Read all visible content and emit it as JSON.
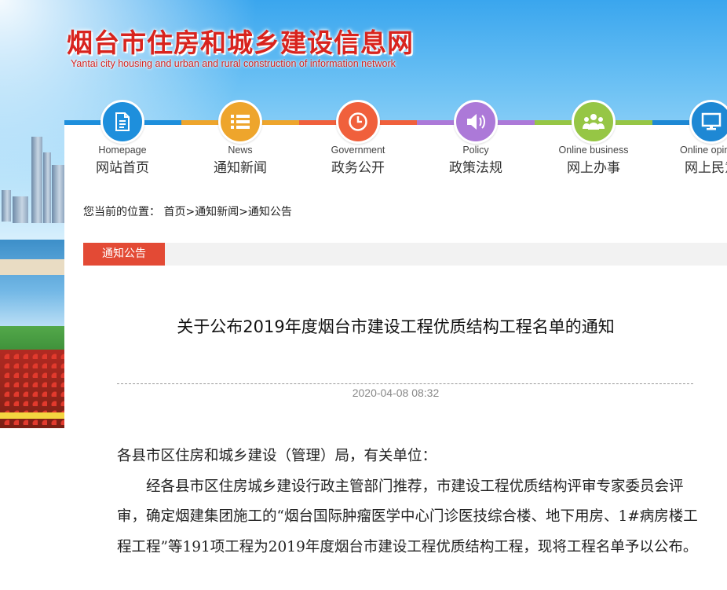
{
  "site": {
    "title": "烟台市住房和城乡建设信息网",
    "subtitle": "Yantai city housing and urban and rural construction of information network"
  },
  "nav": [
    {
      "en": "Homepage",
      "cn": "网站首页",
      "icon": "document-icon",
      "color": "#1e8fdc"
    },
    {
      "en": "News",
      "cn": "通知新闻",
      "icon": "list-icon",
      "color": "#eea52c"
    },
    {
      "en": "Government",
      "cn": "政务公开",
      "icon": "clock-icon",
      "color": "#f0603c"
    },
    {
      "en": "Policy",
      "cn": "政策法规",
      "icon": "speaker-icon",
      "color": "#ac79d8"
    },
    {
      "en": "Online business",
      "cn": "网上办事",
      "icon": "people-icon",
      "color": "#96c645"
    },
    {
      "en": "Online opinion",
      "cn": "网上民意",
      "icon": "monitor-icon",
      "color": "#1e88d4"
    }
  ],
  "breadcrumb": {
    "prefix": "您当前的位置：",
    "home": "首页",
    "news": "通知新闻",
    "current": "通知公告",
    "separator": ">"
  },
  "section": {
    "label": "通知公告"
  },
  "article": {
    "title": "关于公布2019年度烟台市建设工程优质结构工程名单的通知",
    "date": "2020-04-08 08:32",
    "salutation": "各县市区住房和城乡建设（管理）局，有关单位：",
    "paragraph": "经各县市区住房城乡建设行政主管部门推荐，市建设工程优质结构评审专家委员会评审，确定烟建集团施工的“烟台国际肿瘤医学中心门诊医技综合楼、地下用房、1#病房楼工程工程”等191项工程为2019年度烟台市建设工程优质结构工程，现将工程名单予以公布。"
  }
}
